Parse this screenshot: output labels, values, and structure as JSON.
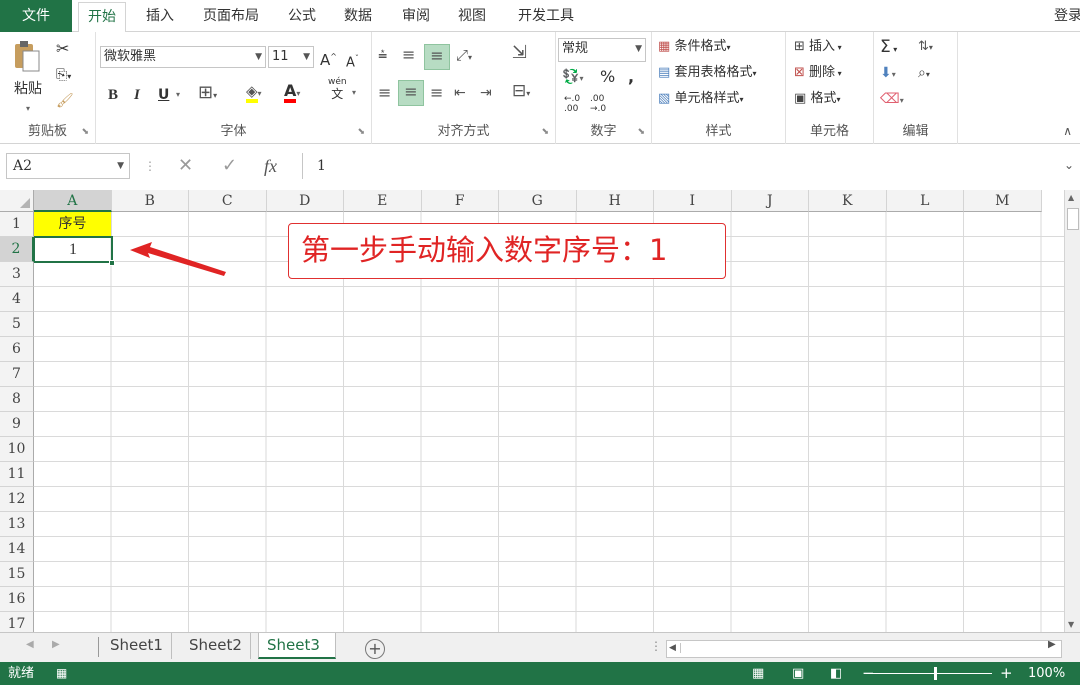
{
  "tabs": [
    "文件",
    "开始",
    "插入",
    "页面布局",
    "公式",
    "数据",
    "审阅",
    "视图",
    "开发工具"
  ],
  "login_label": "登录",
  "ribbon": {
    "clipboard": {
      "paste_label": "粘贴",
      "group_label": "剪贴板"
    },
    "font": {
      "font_name": "微软雅黑",
      "font_size": "11",
      "bold": "B",
      "italic": "I",
      "underline": "U",
      "grow_label": "A",
      "shrink_label": "A",
      "phonetic_label": "wén",
      "phonetic_char": "文",
      "font_color_label": "A",
      "group_label": "字体"
    },
    "align": {
      "group_label": "对齐方式"
    },
    "number": {
      "format": "常规",
      "percent": "%",
      "comma": ",",
      "dec_inc": ".0",
      "dec_dec": ".00",
      "group_label": "数字"
    },
    "styles": {
      "conditional": "条件格式",
      "table": "套用表格格式",
      "cell_styles": "单元格样式",
      "group_label": "样式"
    },
    "cells": {
      "insert": "插入",
      "delete": "删除",
      "format": "格式",
      "group_label": "单元格"
    },
    "editing": {
      "sum": "Σ",
      "group_label": "编辑"
    }
  },
  "formula_bar": {
    "name_box": "A2",
    "fx": "fx",
    "content": "1"
  },
  "grid": {
    "columns": [
      "A",
      "B",
      "C",
      "D",
      "E",
      "F",
      "G",
      "H",
      "I",
      "J",
      "K",
      "L",
      "M"
    ],
    "rows": [
      "1",
      "2",
      "3",
      "4",
      "5",
      "6",
      "7",
      "8",
      "9",
      "10",
      "11",
      "12",
      "13",
      "14",
      "15",
      "16",
      "17"
    ],
    "cell_a1": "序号",
    "cell_a2": "1",
    "selected_column": "A",
    "selected_row": "2",
    "header_fill": "#ffff00"
  },
  "annotation": {
    "text": "第一步手动输入数字序号：1",
    "color": "#e02424"
  },
  "sheets": [
    "Sheet1",
    "Sheet2",
    "Sheet3"
  ],
  "active_sheet": "Sheet3",
  "status": {
    "ready": "就绪",
    "zoom": "100%",
    "zoom_minus": "−",
    "zoom_plus": "+"
  },
  "colors": {
    "accent": "#217346"
  }
}
